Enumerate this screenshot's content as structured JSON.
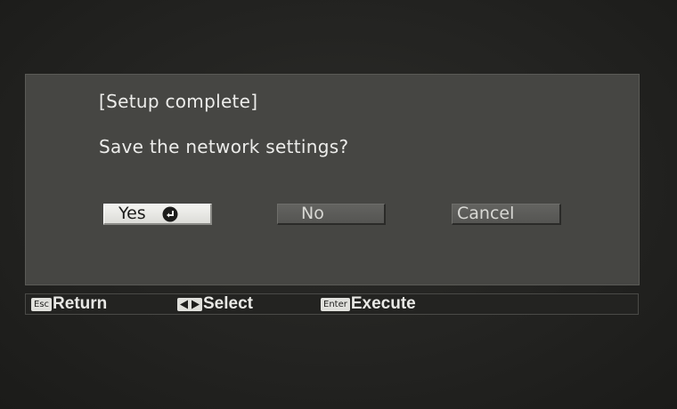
{
  "dialog": {
    "title": "[Setup complete]",
    "message": "Save the network settings?",
    "buttons": {
      "yes": "Yes",
      "no": "No",
      "cancel": "Cancel"
    },
    "selected_button": "yes"
  },
  "footer": {
    "return": {
      "key": "Esc",
      "label": "Return"
    },
    "select": {
      "key_icon": "left-right-arrows-icon",
      "label": "Select"
    },
    "execute": {
      "key": "Enter",
      "label": "Execute"
    }
  },
  "colors": {
    "dialog_background": "#464643",
    "selected_button": "#ececea",
    "page_background": "#232321"
  }
}
